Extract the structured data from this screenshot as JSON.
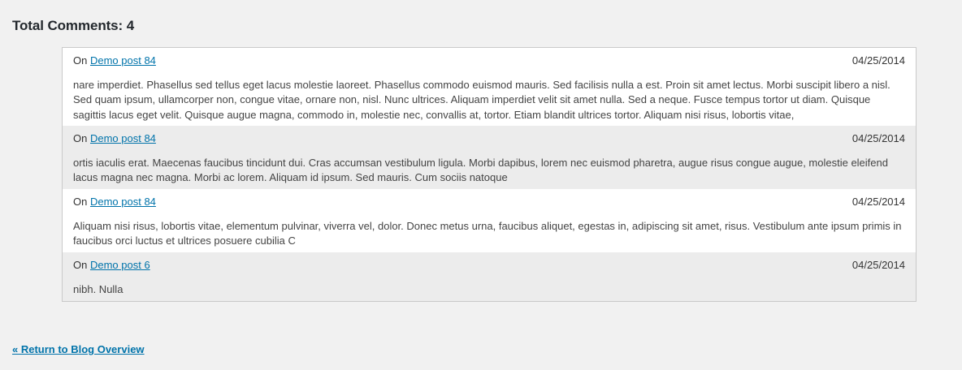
{
  "heading": "Total Comments: 4",
  "comments": [
    {
      "prefix": "On",
      "post_link": "Demo post 84",
      "date": "04/25/2014",
      "text": "nare imperdiet. Phasellus sed tellus eget lacus molestie laoreet. Phasellus commodo euismod mauris. Sed facilisis nulla a est. Proin sit amet lectus. Morbi suscipit libero a nisl. Sed quam ipsum, ullamcorper non, congue vitae, ornare non, nisl. Nunc ultrices. Aliquam imperdiet velit sit amet nulla. Sed a neque. Fusce tempus tortor ut diam. Quisque sagittis lacus eget velit. Quisque augue magna, commodo in, molestie nec, convallis at, tortor. Etiam blandit ultrices tortor. Aliquam nisi risus, lobortis vitae,"
    },
    {
      "prefix": "On",
      "post_link": "Demo post 84",
      "date": "04/25/2014",
      "text": "ortis iaculis erat. Maecenas faucibus tincidunt dui. Cras accumsan vestibulum ligula. Morbi dapibus, lorem nec euismod pharetra, augue risus congue augue, molestie eleifend lacus magna nec magna. Morbi ac lorem. Aliquam id ipsum. Sed mauris. Cum sociis natoque"
    },
    {
      "prefix": "On",
      "post_link": "Demo post 84",
      "date": "04/25/2014",
      "text": "Aliquam nisi risus, lobortis vitae, elementum pulvinar, viverra vel, dolor. Donec metus urna, faucibus aliquet, egestas in, adipiscing sit amet, risus. Vestibulum ante ipsum primis in faucibus orci luctus et ultrices posuere cubilia C"
    },
    {
      "prefix": "On",
      "post_link": "Demo post 6",
      "date": "04/25/2014",
      "text": "nibh. Nulla"
    }
  ],
  "return_link": "« Return to Blog Overview",
  "colors": {
    "link": "#0073aa",
    "alt_row": "#ececec",
    "background": "#f1f1f1"
  }
}
